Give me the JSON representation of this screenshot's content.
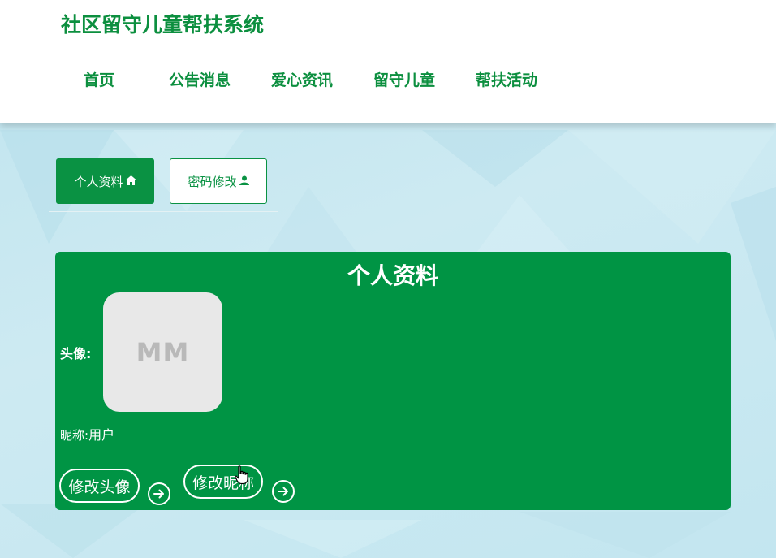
{
  "site": {
    "title": "社区留守儿童帮扶系统"
  },
  "nav": {
    "items": [
      {
        "label": "首页"
      },
      {
        "label": "公告消息"
      },
      {
        "label": "爱心资讯"
      },
      {
        "label": "留守儿童"
      },
      {
        "label": "帮扶活动"
      }
    ]
  },
  "tabs": {
    "profile": {
      "label": "个人资料",
      "icon": "home-icon"
    },
    "password": {
      "label": "密码修改",
      "icon": "user-icon"
    }
  },
  "profile": {
    "title": "个人资料",
    "avatar_label": "头像:",
    "avatar_placeholder": "MM",
    "nickname_label": "昵称:",
    "nickname_value": "用户",
    "change_avatar_label": "修改头像",
    "change_nickname_label": "修改昵称"
  },
  "colors": {
    "brand_green": "#0c8f3f",
    "card_green": "#009444",
    "background": "#c9e8f1"
  }
}
